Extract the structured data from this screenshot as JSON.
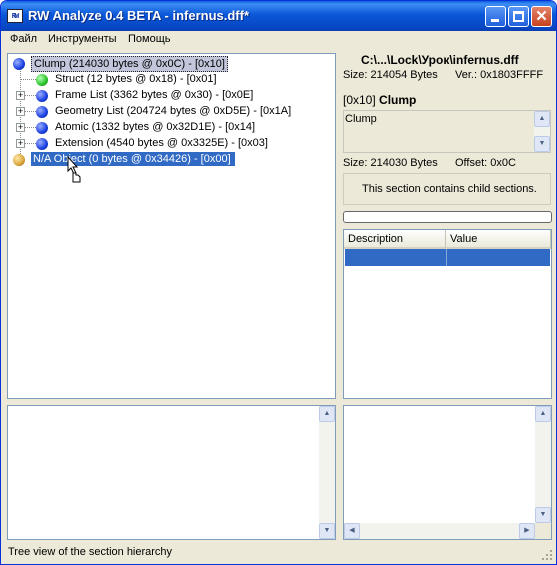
{
  "window": {
    "title": "RW Analyze 0.4 BETA - infernus.dff*",
    "icon_text": "RW"
  },
  "menu": [
    "Файл",
    "Инструменты",
    "Помощь"
  ],
  "tree": {
    "items": [
      {
        "label": "Clump  (214030 bytes @ 0x0C) - [0x10]",
        "color": "#1a3fe0",
        "state": "selected-inactive"
      },
      {
        "label": "Struct  (12 bytes @ 0x18) - [0x01]",
        "color": "#27c227"
      },
      {
        "label": "Frame List  (3362 bytes @ 0x30) - [0x0E]",
        "color": "#1a3fe0",
        "expander": "+"
      },
      {
        "label": "Geometry List  (204724 bytes @ 0xD5E) - [0x1A]",
        "color": "#1a3fe0",
        "expander": "+"
      },
      {
        "label": "Atomic  (1332 bytes @ 0x32D1E) - [0x14]",
        "color": "#1a3fe0",
        "expander": "+"
      },
      {
        "label": "Extension  (4540 bytes @ 0x3325E) - [0x03]",
        "color": "#1a3fe0",
        "expander": "+"
      },
      {
        "label": "N/A Object  (0 bytes @ 0x34426) - [0x00]",
        "color": "#d9a43a",
        "state": "selected-active"
      }
    ]
  },
  "file_info": {
    "path": "C:\\...\\Lock\\Урок\\infernus.dff",
    "size": "Size: 214054 Bytes",
    "version": "Ver.: 0x1803FFFF"
  },
  "section": {
    "id": "[0x10]",
    "name": "Clump",
    "description": "Clump",
    "size": "Size: 214030 Bytes",
    "offset": "Offset: 0x0C",
    "child_message": "This section contains child sections."
  },
  "progress": {
    "value": 0.0
  },
  "properties": {
    "columns": [
      "Description",
      "Value"
    ]
  },
  "status": {
    "text": "Tree view of the section hierarchy"
  },
  "colors": {
    "selection": "#316ac5",
    "titlebar": "#0a57d9",
    "border": "#7f9db9"
  }
}
